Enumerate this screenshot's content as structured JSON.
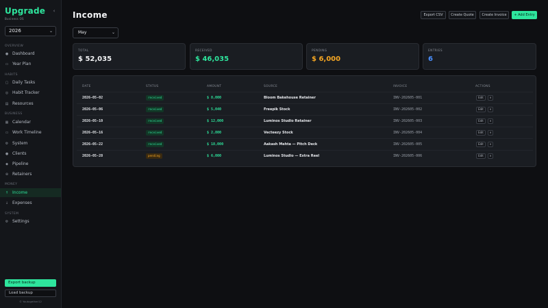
{
  "sidebar": {
    "logo": "Upgrade",
    "subtitle": "Business OS",
    "year": "2026",
    "sections": {
      "overview": "OVERVIEW",
      "habits": "HABITS",
      "business": "BUSINESS",
      "money": "MONEY",
      "system": "SYSTEM"
    },
    "items": {
      "dashboard": "Dashboard",
      "year_plan": "Year Plan",
      "daily_tasks": "Daily Tasks",
      "habit_tracker": "Habit Tracker",
      "resources": "Resources",
      "calendar": "Calendar",
      "work_timeline": "Work Timeline",
      "system": "System",
      "clients": "Clients",
      "pipeline": "Pipeline",
      "retainers": "Retainers",
      "income": "Income",
      "expenses": "Expenses",
      "settings": "Settings"
    },
    "export_label": "Export backup",
    "load_label": "Load backup",
    "footer": "© Youtogether12"
  },
  "header": {
    "title": "Income",
    "export_csv": "Export CSV",
    "create_quote": "Create Quote",
    "create_invoice": "Create Invoice",
    "add_entry": "+ Add Entry"
  },
  "filter": {
    "month": "May"
  },
  "stats": [
    {
      "label": "TOTAL",
      "value": "$ 52,035",
      "color": "#f2f3f5"
    },
    {
      "label": "RECEIVED",
      "value": "$ 46,035",
      "color": "#2ee59d"
    },
    {
      "label": "PENDING",
      "value": "$ 6,000",
      "color": "#f5a623"
    },
    {
      "label": "ENTRIES",
      "value": "6",
      "color": "#4a90ff"
    }
  ],
  "table": {
    "headers": {
      "date": "DATE",
      "status": "STATUS",
      "amount": "AMOUNT",
      "source": "SOURCE",
      "invoice": "INVOICE",
      "actions": "ACTIONS"
    },
    "edit_label": "Edit",
    "delete_label": "×",
    "rows": [
      {
        "date": "2026-05-02",
        "status": "received",
        "amount": "$ 8,000",
        "source": "Bloom Bakehouse Retainer",
        "invoice": "INV-202605-001"
      },
      {
        "date": "2026-05-06",
        "status": "received",
        "amount": "$ 5,040",
        "source": "Freepik Stock",
        "invoice": "INV-202605-002"
      },
      {
        "date": "2026-05-10",
        "status": "received",
        "amount": "$ 12,000",
        "source": "Luminos Studio Retainer",
        "invoice": "INV-202605-003"
      },
      {
        "date": "2026-05-16",
        "status": "received",
        "amount": "$ 2,800",
        "source": "Vecteezy Stock",
        "invoice": "INV-202605-004"
      },
      {
        "date": "2026-05-22",
        "status": "received",
        "amount": "$ 18,000",
        "source": "Aakash Mehta — Pitch Deck",
        "invoice": "INV-202605-005"
      },
      {
        "date": "2026-05-28",
        "status": "pending",
        "amount": "$ 6,000",
        "source": "Luminos Studio — Extra Reel",
        "invoice": "INV-202605-006"
      }
    ]
  },
  "colors": {
    "accent": "#2ee59d",
    "pending": "#f5a623",
    "entries": "#4a90ff"
  }
}
